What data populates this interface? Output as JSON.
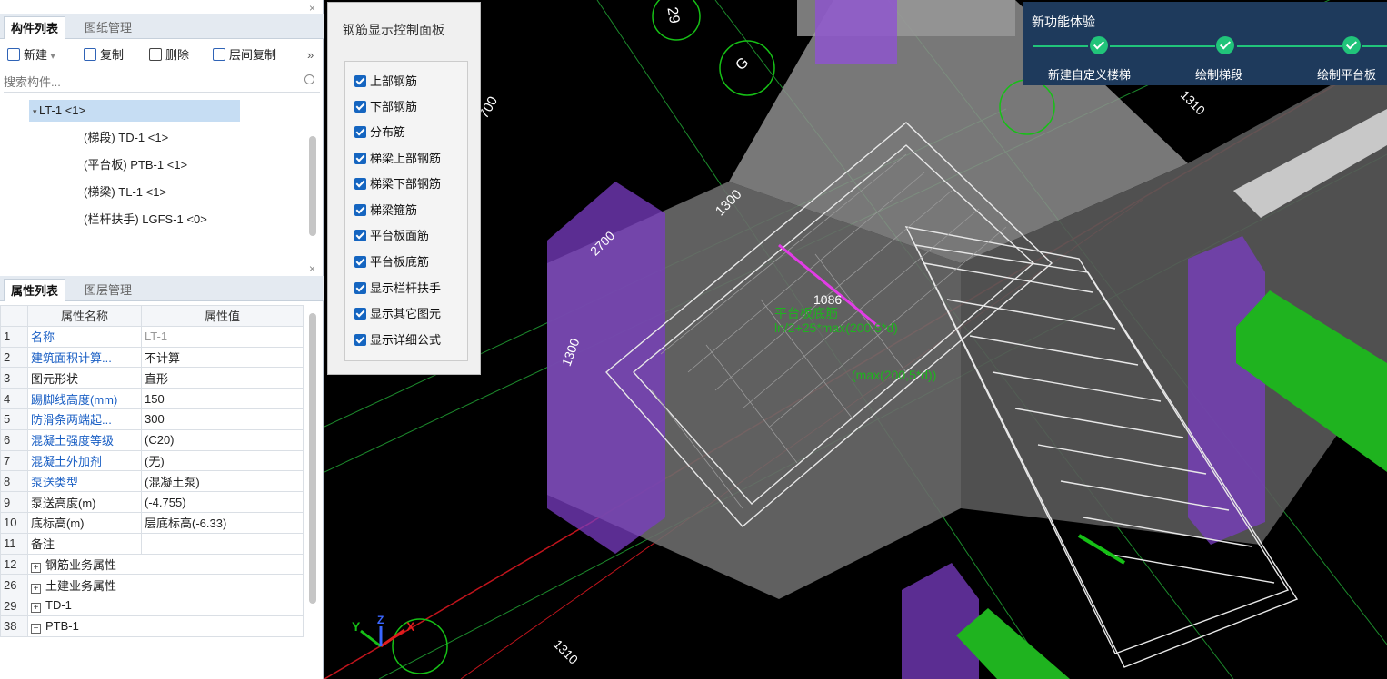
{
  "component_panel": {
    "tabs": [
      "构件列表",
      "图纸管理"
    ],
    "toolbar": {
      "new": "新建",
      "copy": "复制",
      "delete": "删除",
      "floor_copy": "层间复制",
      "more": "»"
    },
    "search_placeholder": "搜索构件...",
    "tree": [
      {
        "label": "LT-1 <1>",
        "selected": true
      },
      {
        "label": "(梯段) TD-1 <1>"
      },
      {
        "label": "(平台板) PTB-1 <1>"
      },
      {
        "label": "(梯梁) TL-1 <1>"
      },
      {
        "label": "(栏杆扶手) LGFS-1 <0>"
      }
    ]
  },
  "property_panel": {
    "tabs": [
      "属性列表",
      "图层管理"
    ],
    "headers": [
      "属性名称",
      "属性值"
    ],
    "rows": [
      {
        "num": "1",
        "name": "名称",
        "value": "LT-1"
      },
      {
        "num": "2",
        "name": "建筑面积计算...",
        "value": "不计算"
      },
      {
        "num": "3",
        "name": "图元形状",
        "value": "直形"
      },
      {
        "num": "4",
        "name": "踢脚线高度(mm)",
        "value": "150"
      },
      {
        "num": "5",
        "name": "防滑条两端起...",
        "value": "300"
      },
      {
        "num": "6",
        "name": "混凝土强度等级",
        "value": "(C20)"
      },
      {
        "num": "7",
        "name": "混凝土外加剂",
        "value": "(无)"
      },
      {
        "num": "8",
        "name": "泵送类型",
        "value": "(混凝土泵)"
      },
      {
        "num": "9",
        "name": "泵送高度(m)",
        "value": "(-4.755)"
      },
      {
        "num": "10",
        "name": "底标高(m)",
        "value": "层底标高(-6.33)"
      },
      {
        "num": "11",
        "name": "备注",
        "value": ""
      },
      {
        "num": "12",
        "name": "钢筋业务属性",
        "value": "",
        "expander": "+"
      },
      {
        "num": "26",
        "name": "土建业务属性",
        "value": "",
        "expander": "+"
      },
      {
        "num": "29",
        "name": "TD-1",
        "value": "",
        "expander": "+"
      },
      {
        "num": "38",
        "name": "PTB-1",
        "value": "",
        "expander": "−"
      }
    ]
  },
  "rebar_panel": {
    "title": "钢筋显示控制面板",
    "options": [
      {
        "label": "上部钢筋",
        "checked": true
      },
      {
        "label": "下部钢筋",
        "checked": true
      },
      {
        "label": "分布筋",
        "checked": true
      },
      {
        "label": "梯梁上部钢筋",
        "checked": true
      },
      {
        "label": "梯梁下部钢筋",
        "checked": true
      },
      {
        "label": "梯梁箍筋",
        "checked": true
      },
      {
        "label": "平台板面筋",
        "checked": true
      },
      {
        "label": "平台板底筋",
        "checked": true
      },
      {
        "label": "显示栏杆扶手",
        "checked": true
      },
      {
        "label": "显示其它图元",
        "checked": true
      },
      {
        "label": "显示详细公式",
        "checked": true
      }
    ]
  },
  "new_feature": {
    "title": "新功能体验",
    "steps": [
      "新建自定义楼梯",
      "绘制梯段",
      "绘制平台板"
    ]
  },
  "viewport": {
    "dimensions": [
      "1310",
      "1300",
      "2700",
      "1300",
      "1310",
      "700"
    ],
    "axis_tags": [
      "29",
      "G"
    ],
    "rebar_length": "1086",
    "formula_line1": "平台板底筋",
    "formula_line2": "ln/2+25*max(200,5*d)",
    "formula_line3": "(max(200,5*d))",
    "axes": [
      "X",
      "Y",
      "Z"
    ]
  }
}
